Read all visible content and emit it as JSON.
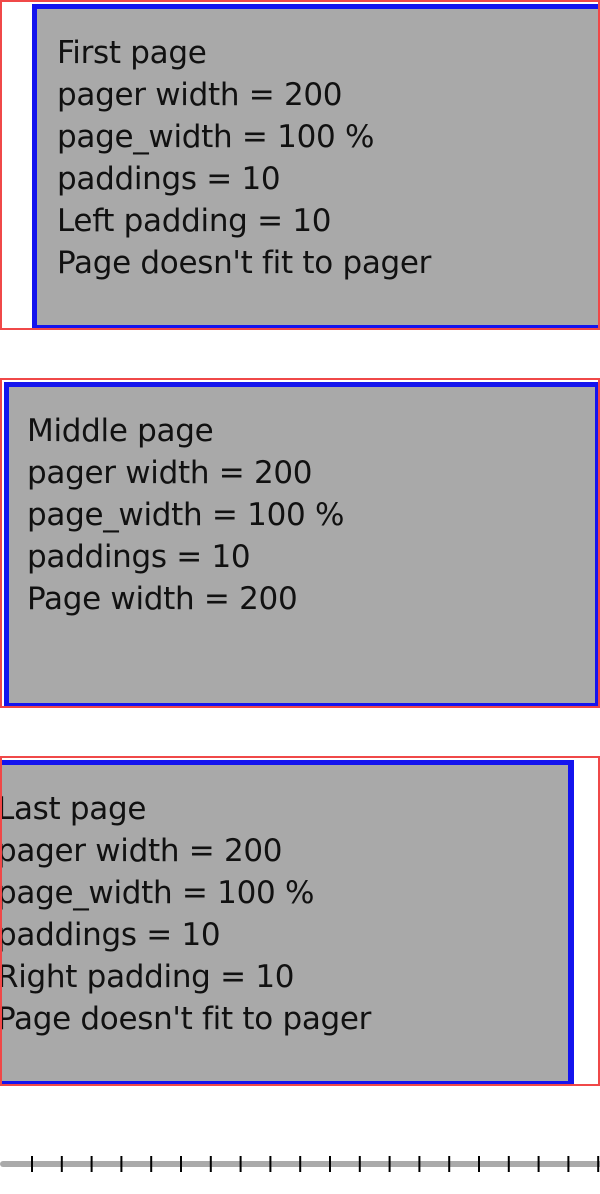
{
  "pages": [
    {
      "lines": [
        "First page",
        "pager width = 200",
        "page_width = 100 %",
        "paddings = 10",
        "Left padding = 10",
        "Page doesn't fit to pager"
      ]
    },
    {
      "lines": [
        "Middle page",
        "pager width = 200",
        "page_width = 100 %",
        "paddings = 10",
        "Page width = 200"
      ]
    },
    {
      "lines": [
        "Last page",
        "pager width = 200",
        "page_width = 100 %",
        "paddings = 10",
        "Right padding = 10",
        "Page doesn't fit to pager"
      ]
    }
  ],
  "colors": {
    "frame_border": "#f04848",
    "page_border": "#1414ee",
    "page_background": "#a9a9a9",
    "track": "#aaaaaa",
    "tick": "#000000"
  }
}
